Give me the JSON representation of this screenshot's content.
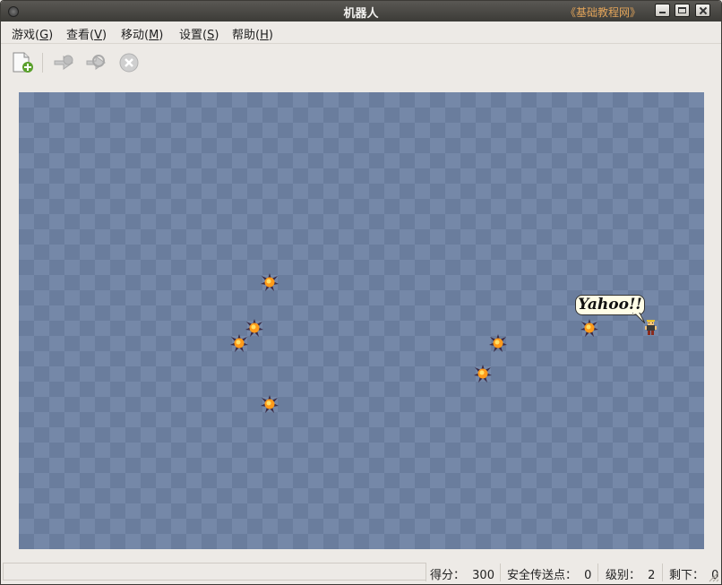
{
  "window": {
    "title": "机器人",
    "watermark": "《基础教程网》"
  },
  "menu": {
    "items": [
      {
        "label": "游戏(",
        "key": "G",
        "end": ")"
      },
      {
        "label": "查看(",
        "key": "V",
        "end": ")"
      },
      {
        "label": "移动(",
        "key": "M",
        "end": ")"
      },
      {
        "label": "设置(",
        "key": "S",
        "end": ")"
      },
      {
        "label": "帮助(",
        "key": "H",
        "end": ")"
      }
    ]
  },
  "toolbar": {
    "tools": [
      {
        "icon": "new-game-icon",
        "enabled": true
      },
      {
        "icon": "teleport-icon",
        "enabled": false
      },
      {
        "icon": "teleport-random-icon",
        "enabled": false
      },
      {
        "icon": "stop-icon",
        "enabled": false
      }
    ]
  },
  "game": {
    "speech": "Yahoo!!",
    "colors": {
      "board_light": "#7588a8",
      "board_dark": "#6a7d9d",
      "junk_core": "#ff9a1a"
    }
  },
  "status": {
    "score_label": "得分：",
    "score": "300",
    "safe_label": "安全传送点：",
    "safe": "0",
    "level_label": "级别：",
    "level": "2",
    "remaining_label": "剩下：",
    "remaining": "0"
  }
}
